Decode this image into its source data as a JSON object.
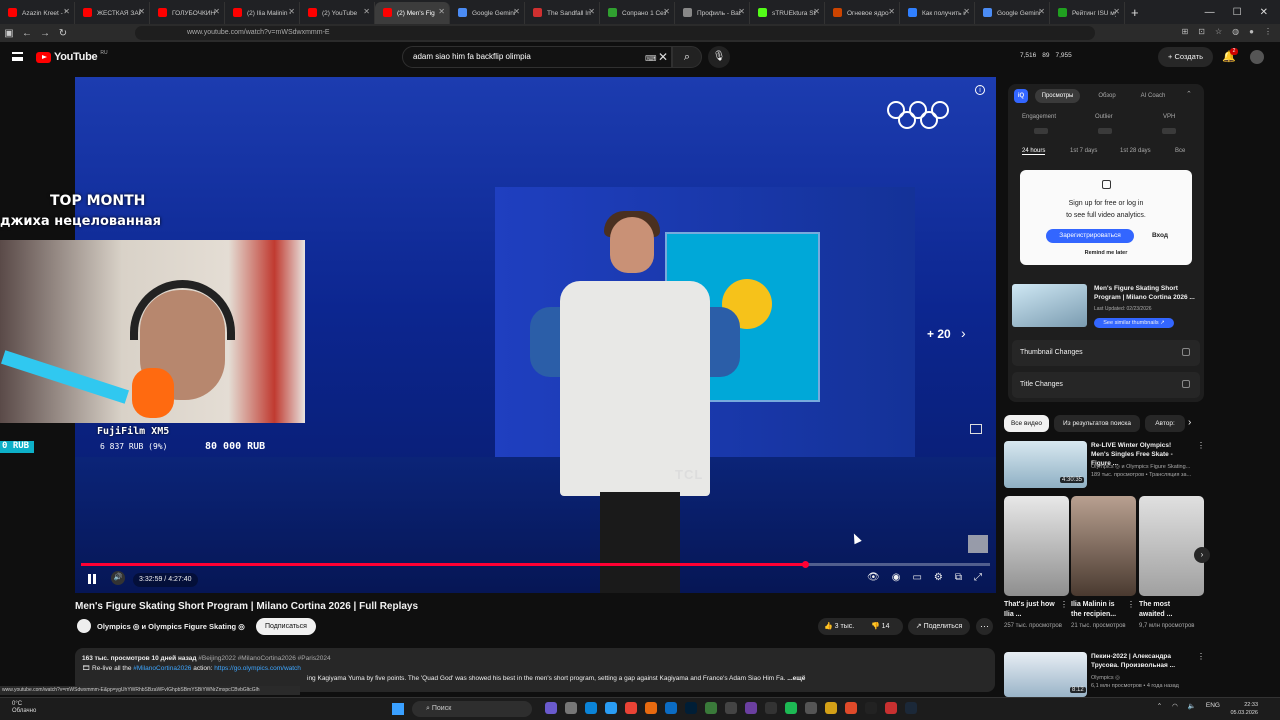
{
  "browser": {
    "tabs": [
      {
        "label": "Azazin Kreet - Yo",
        "color": "#ff0000",
        "active": false
      },
      {
        "label": "ЖЕСТКАЯ ЗАРУБ",
        "color": "#ff0000",
        "active": false
      },
      {
        "label": "ГОЛУБОЧКИН У",
        "color": "#ff0000",
        "active": false
      },
      {
        "label": "(2) Ilia Malinin - 2",
        "color": "#ff0000",
        "active": false
      },
      {
        "label": "(2) YouTube",
        "color": "#ff0000",
        "active": false
      },
      {
        "label": "(2) Men's Fig",
        "color": "#ff0000",
        "active": true
      },
      {
        "label": "Google Gemini",
        "color": "#4b8cf5",
        "active": false
      },
      {
        "label": "The Sandfall Inter",
        "color": "#d03030",
        "active": false
      },
      {
        "label": "Сопрано 1 Сезо",
        "color": "#30a030",
        "active": false
      },
      {
        "label": "Профиль - Battle",
        "color": "#888888",
        "active": false
      },
      {
        "label": "sTRUEktura Strea",
        "color": "#53fc18",
        "active": false
      },
      {
        "label": "Огневое ядро ч",
        "color": "#cc4400",
        "active": false
      },
      {
        "label": "Как получить и с",
        "color": "#3080ff",
        "active": false
      },
      {
        "label": "Google Gemini",
        "color": "#4b8cf5",
        "active": false
      },
      {
        "label": "Рейтинг ISU муж",
        "color": "#20a020",
        "active": false
      }
    ],
    "url": "www.youtube.com/watch?v=mWSdwxmmm-E",
    "status_url": "www.youtube.com/watch?v=mWSdwxmmm-E&pp=ygUhYWRhbSBzaWFvIGhpbSBmYSBiYWNrZmxpcCBvbGltcGlh"
  },
  "header": {
    "logo_text": "YouTube",
    "logo_region": "RU",
    "search_value": "adam siao him fa backflip olimpia",
    "stats": [
      "7,516",
      "89",
      "7,955"
    ],
    "create_label": "Создать",
    "notif_count": "2"
  },
  "video": {
    "time": "3:32:59 / 4:27:40",
    "progress_fraction": 0.797,
    "skip_label": "+ 20",
    "sponsor_text": "TCL",
    "overlay_title1": "TOP MONTH",
    "overlay_title2": "джиха нецелованная",
    "cam_model": "FujiFilm XM5",
    "goal_start": "0 RUB",
    "goal_current": "6 837 RUB (9%)",
    "goal_end": "80 000 RUB",
    "goal_fraction": 0.09,
    "colors": {
      "accent": "#ff0033"
    }
  },
  "meta": {
    "title": "Men's Figure Skating Short Program | Milano Cortina 2026 | Full Replays",
    "channel": "Olympics ◎ и Olympics Figure Skating ◎",
    "subscribe_label": "Подписаться",
    "likes": "3 тыс.",
    "dislikes": "14",
    "share_label": "Поделиться",
    "desc_stats": "163 тыс. просмотров  10 дней назад",
    "desc_tags": "#Beijing2022 #MilanoCortina2026 #Paris2024",
    "desc_line2_prefix": "🎞 Re-live all the",
    "desc_line2_link1": "#MilanoCortina2026",
    "desc_line2_mid": "action:",
    "desc_line2_link2": "https://go.olympics.com/watch",
    "desc_line3": "ing Kagiyama Yuma by five points. The 'Quad God' was showed his best in the men's short program, setting a gap against Kagiyama and France's Adam Siao Him Fa.",
    "desc_more": "...ещё"
  },
  "iq": {
    "logo": "iQ",
    "tabs": [
      "Просмотры",
      "Обзор",
      "AI Coach"
    ],
    "metrics": [
      "Engagement",
      "Outlier",
      "VPH"
    ],
    "periods": [
      "24 hours",
      "1st 7 days",
      "1st 28 days",
      "Все"
    ],
    "signup_line1": "Sign up for free or log in",
    "signup_line2": "to see full video analytics.",
    "register_label": "Зарегистрироваться",
    "login_label": "Вход",
    "remind_label": "Remind me later",
    "thumb_title": "Men's Figure Skating Short Program | Milano Cortina 2026 ...",
    "thumb_updated": "Last Updated: 02/23/2026",
    "similar_label": "See similar thumbnails ↗",
    "locked_rows": [
      "Thumbnail Changes",
      "Title Changes"
    ]
  },
  "chips": [
    "Все видео",
    "Из результатов поиска",
    "Автор:"
  ],
  "related": [
    {
      "title": "Re-LIVE Winter Olympics! Men's Singles Free Skate - Figure ...",
      "channel": "Olympics ◎ и Olympics Figure Skating...",
      "meta": "189 тыс. просмотров • Трансляция за...",
      "duration": "4:30:35"
    },
    {
      "title": "Пекин-2022 | Александра Трусова. Произвольная ...",
      "channel": "Olympics ◎",
      "meta": "6,1 млн просмотров • 4 года назад",
      "duration": "8:12"
    }
  ],
  "shorts": [
    {
      "title": "That's just how Ilia ...",
      "meta": "257 тыс. просмотров"
    },
    {
      "title": "Ilia Malinin is the recipien...",
      "meta": "21 тыс. просмотров"
    },
    {
      "title": "The most awaited ...",
      "meta": "9,7 млн просмотров"
    }
  ],
  "taskbar": {
    "weather_temp": "0°C",
    "weather_desc": "Облачно",
    "search_label": "Поиск",
    "lang": "ENG",
    "time": "22:33",
    "date": "05.03.2026"
  }
}
